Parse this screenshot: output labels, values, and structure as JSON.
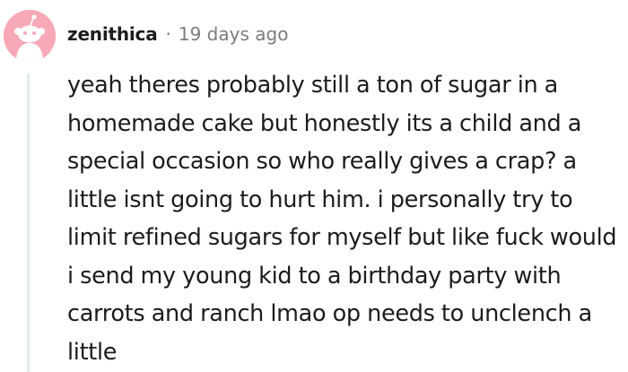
{
  "comment": {
    "author": "zenithica",
    "separator": "·",
    "timestamp": "19 days ago",
    "text": "yeah theres probably still a ton of sugar in a homemade cake but honestly its a child and a special occasion so who really gives a crap? a little isnt going to hurt him. i personally try to limit refined sugars for myself but like fuck would i send my young kid to a birthday party with carrots and ranch lmao op needs to unclench a little"
  },
  "icons": {
    "avatar": "snoo-avatar-icon"
  },
  "colors": {
    "avatar_background": "#f7a9b6",
    "thread_line": "#e6eaee",
    "meta_gray": "#7c7c7c",
    "text": "#1c1c1c"
  }
}
